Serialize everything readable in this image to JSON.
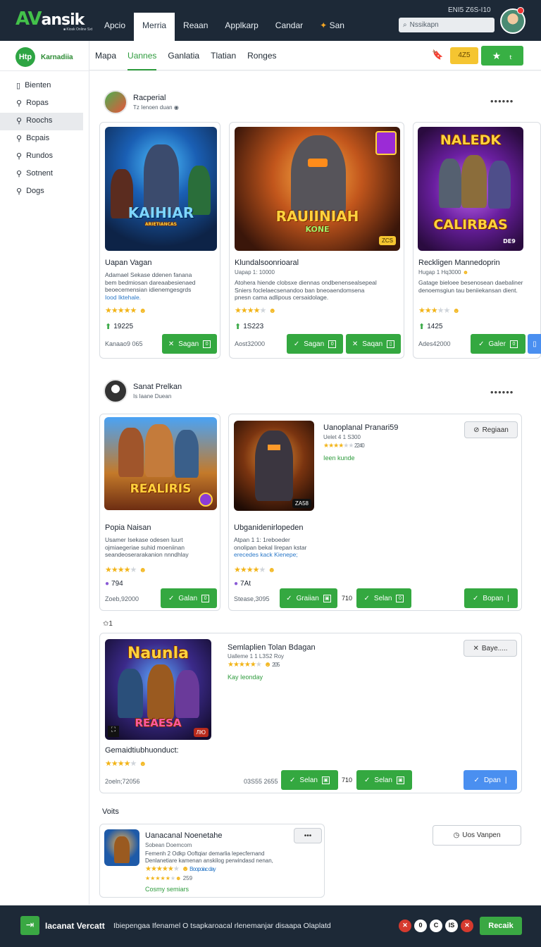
{
  "header": {
    "logo_main": "AV",
    "logo_rest": "ansik",
    "logo_sub": "■ Kiosk Online Sxt",
    "nav": [
      "Apcio",
      "Merria",
      "Reaan",
      "Applkarp",
      "Candar",
      "San"
    ],
    "active_nav": "Merria",
    "search_placeholder": "Nssikapn",
    "clock": "ENI5 Z6S-I10"
  },
  "sidebar": {
    "brand_icon": "Htp",
    "brand_label": "Karnadiia",
    "items": [
      {
        "label": "Bienten",
        "active": false
      },
      {
        "label": "Ropas",
        "active": false
      },
      {
        "label": "Roochs",
        "active": true
      },
      {
        "label": "Bcpais",
        "active": false
      },
      {
        "label": "Rundos",
        "active": false
      },
      {
        "label": "Sotnent",
        "active": false
      },
      {
        "label": "Dogs",
        "active": false
      }
    ]
  },
  "subnav": {
    "tabs": [
      "Mapa",
      "Uannes",
      "Ganlatia",
      "Tlatian",
      "Ronges"
    ],
    "active_tab": "Uannes",
    "pill": "4Z5",
    "colors": {
      "accent": "#38b044",
      "pill": "#f5c531",
      "header": "#1d2937"
    }
  },
  "section1": {
    "title": "Racperial",
    "subtitle": "Tz Ienoen duan",
    "cards": [
      {
        "art_title": "KAIHIAR",
        "art_sub": "ARIETIANCAS",
        "name": "Uapan Vagan",
        "desc": [
          "Adamael Sekase ddenen fanana",
          "bem bedmiosan dareaabesienaed",
          "beoecemensian idienemgesgrds"
        ],
        "link": "Iood Iktehale.",
        "rating": 4,
        "count": "19225",
        "price": "Kanaao9 065",
        "btn1": "Sagan"
      },
      {
        "art_title": "RAUIINIAH",
        "art_sub": "KONE",
        "art_tag": "ZCS",
        "name": "Klundalsoonrioaral",
        "meta": "Uapap 1: 10000",
        "desc": [
          "Atohera hiende clobsxe diennas ondbenensealsepeal",
          "Sniers foclelaecsenandoo ban bneoaendomsena",
          "pnesn cama adlipous cersaidolage."
        ],
        "rating": 4,
        "count": "1S223",
        "price": "Aost32000",
        "btn1": "Sagan",
        "btn2": "Saqan"
      },
      {
        "art_title": "NALEDK",
        "art_sub": "CALIRBAS",
        "art_tag": "DE9",
        "name": "Reckligen Mannedoprin",
        "meta": "Hugap 1 Hq3000",
        "desc": [
          "Gatage bieloee besenosean daebaliner",
          "denoemsgiun tau beniiekansan dient."
        ],
        "rating": 3,
        "count": "1425",
        "price": "Ades42000",
        "btn1": "Galer"
      }
    ]
  },
  "section2": {
    "title": "Sanat Prelkan",
    "subtitle": "Is Iaane Duean",
    "cards": [
      {
        "art_title": "REALIRIS",
        "name": "Popia Naisan",
        "desc": [
          "Usamer Isekase odesen luurt",
          "ojmiaegeriae suhid moeniinan",
          "seandeoserarakanion nnndhlay"
        ],
        "rating": 4,
        "count": "794",
        "price": "Zoeb,92000",
        "btn1": "Galan"
      },
      {
        "art_tag": "ZA58",
        "title": "Uanoplanal Pranari59",
        "meta": "Uelet 4 1 S300",
        "meta_num": "2240",
        "green": "Ieen kunde",
        "opt_btn": "Regiaan",
        "name": "Ubganidenirlopeden",
        "desc": [
          "Atpan 1 1: 1reboeder",
          "onolipan bekal lirepan kstar",
          "erecedes kack Kienepe;"
        ],
        "rating": 4,
        "count": "7At",
        "price": "Stease,3095",
        "btn1": "Graiian",
        "mid": "710",
        "btn2": "Selan",
        "btn3": "Bopan"
      }
    ]
  },
  "section3": {
    "label": "1",
    "art_title": "Naunla",
    "art_sub": "REAESA",
    "art_tag": "ЛЮ",
    "title": "Semlaplien Tolan Bdagan",
    "meta": "Ualleme 1 1 L3S2 Roy",
    "meta_num": "205",
    "green": "Kay Ieonday",
    "opt_btn": "Baye.....",
    "name": "Gemaidtiubhuonduct:",
    "rating": 4,
    "price": "2oeln;72056",
    "price2": "03S55 2655",
    "btn1": "Selan",
    "mid": "710",
    "btn2": "Selan",
    "btn3": "Dpan"
  },
  "section4": {
    "title": "Voits",
    "card_title": "Uanacanal Noenetahe",
    "card_meta": "Sobean Doemcom",
    "desc": [
      "Femenh 2 Odkp Ooftqiar demarlia lepecfernand",
      "Denlanetiare kamenan anskilog perwindasd nenan,"
    ],
    "link": "Boopoiac day",
    "meta_num": "259",
    "green": "Cosmy semiars",
    "wide_btn": "Uos Vanpen"
  },
  "footer": {
    "title": "Iacanat Vercatt",
    "text": "Ibiepengaa Ifenamel O tsapkaroacal rlenemanjar disaapa Olaplatd",
    "circles": [
      "✕",
      "0",
      "C",
      "IS",
      "✕"
    ],
    "button": "Recaik"
  }
}
